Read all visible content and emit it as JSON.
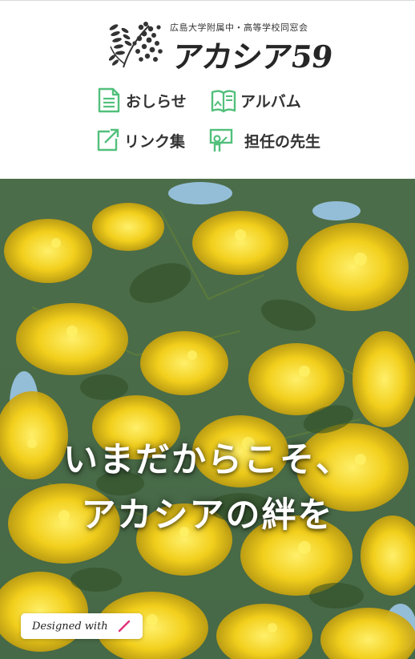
{
  "header": {
    "subtitle": "広島大学附属中・高等学校同窓会",
    "title": "アカシア59"
  },
  "nav": {
    "items": [
      {
        "id": "news",
        "label": "おしらせ",
        "icon": "document-icon"
      },
      {
        "id": "album",
        "label": "アルバム",
        "icon": "album-icon"
      },
      {
        "id": "links",
        "label": "リンク集",
        "icon": "external-link-icon"
      },
      {
        "id": "teacher",
        "label": "担任の先生",
        "icon": "teacher-icon"
      }
    ]
  },
  "hero": {
    "line1": "いまだからこそ、",
    "line2": "アカシアの絆を"
  },
  "badge": {
    "label": "Designed with",
    "icon": "pencil-icon"
  },
  "colors": {
    "icon_green": "#52c07b",
    "text": "#333333",
    "foliage": "#3a5a2c",
    "blossom": "#f2cf1c",
    "sky": "#9cc6e8",
    "pencil": "#e0307a"
  }
}
